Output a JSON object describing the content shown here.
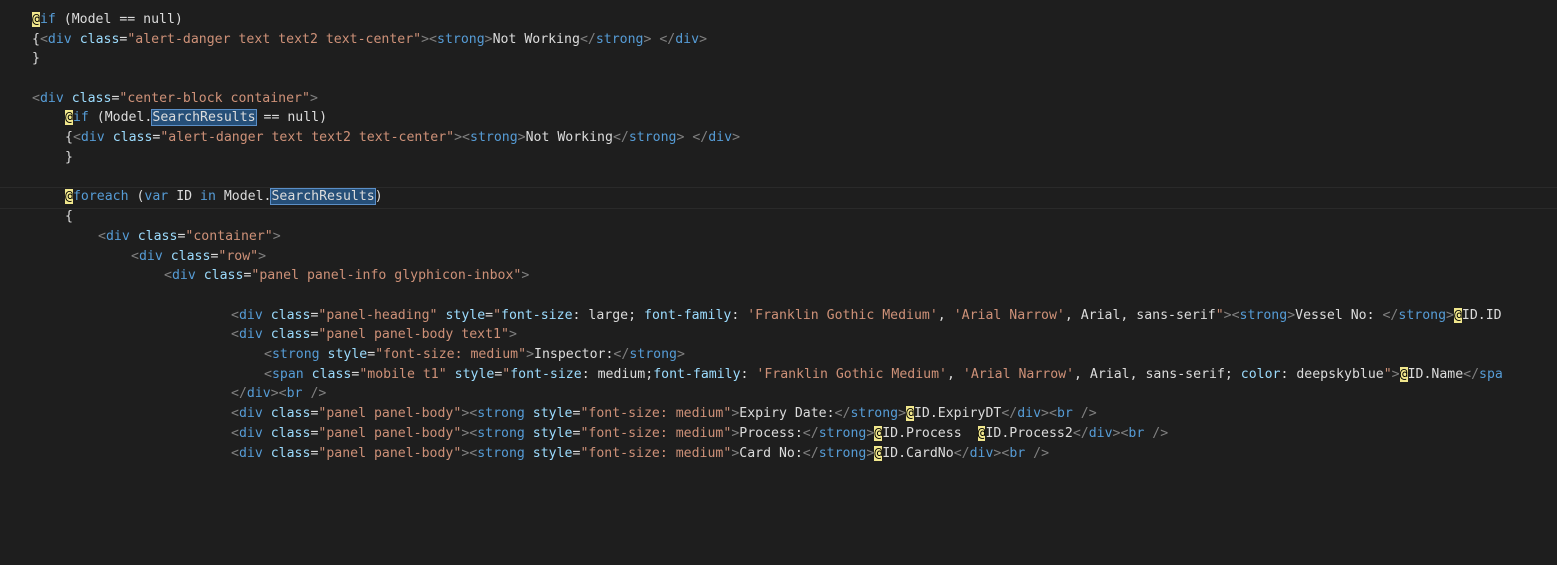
{
  "code": {
    "t_if": "if",
    "t_model_eq_null": " (Model == null)",
    "t_div": "div",
    "t_class": "class",
    "t_strong": "strong",
    "t_style": "style",
    "t_span": "span",
    "t_br": "br",
    "t_foreach": "foreach",
    "t_var": "var",
    "t_in": "in",
    "v_alert": "\"alert-danger text text2 text-center\"",
    "txt_not_working": "Not Working",
    "v_center_block": "\"center-block container\"",
    "t_model_dot": " (Model.",
    "t_search_results": "SearchResults",
    "t_eq_null_close": " == null)",
    "t_id": " ID ",
    "t_model_dot2": " Model.",
    "v_container": "\"container\"",
    "v_row": "\"row\"",
    "v_panel_info": "\"panel panel-info glyphicon-inbox\"",
    "v_panel_heading": "\"panel-heading\"",
    "v_style_heading_open": "\"",
    "p_font_size": "font-size",
    "p_font_family": "font-family",
    "p_color": "color",
    "val_large": " large; ",
    "s_franklin": "'Franklin Gothic Medium'",
    "s_arial_narrow": "'Arial Narrow'",
    "val_arial_sans": ", Arial, sans-serif",
    "txt_vessel_no": "Vessel No: ",
    "txt_id_id": "ID.ID",
    "v_panel_body_text1": "\"panel panel-body text1\"",
    "v_fs_medium": "\"font-size: medium\"",
    "txt_inspector": "Inspector:",
    "v_mobile_t1": "\"mobile t1\"",
    "val_medium_semi": " medium;",
    "val_arial_sans_semi": ", Arial, sans-serif; ",
    "val_deepskyblue": " deepskyblue",
    "txt_id_name": "ID.Name",
    "t_spa": "spa",
    "v_panel_body": "\"panel panel-body\"",
    "txt_expiry_date": "Expiry Date:",
    "txt_id_expirydt": "ID.ExpiryDT",
    "txt_process": "Process:",
    "txt_id_process": "ID.Process  ",
    "txt_id_process2": "ID.Process2",
    "txt_card_no": "Card No:",
    "txt_id_cardno": "ID.CardNo"
  }
}
